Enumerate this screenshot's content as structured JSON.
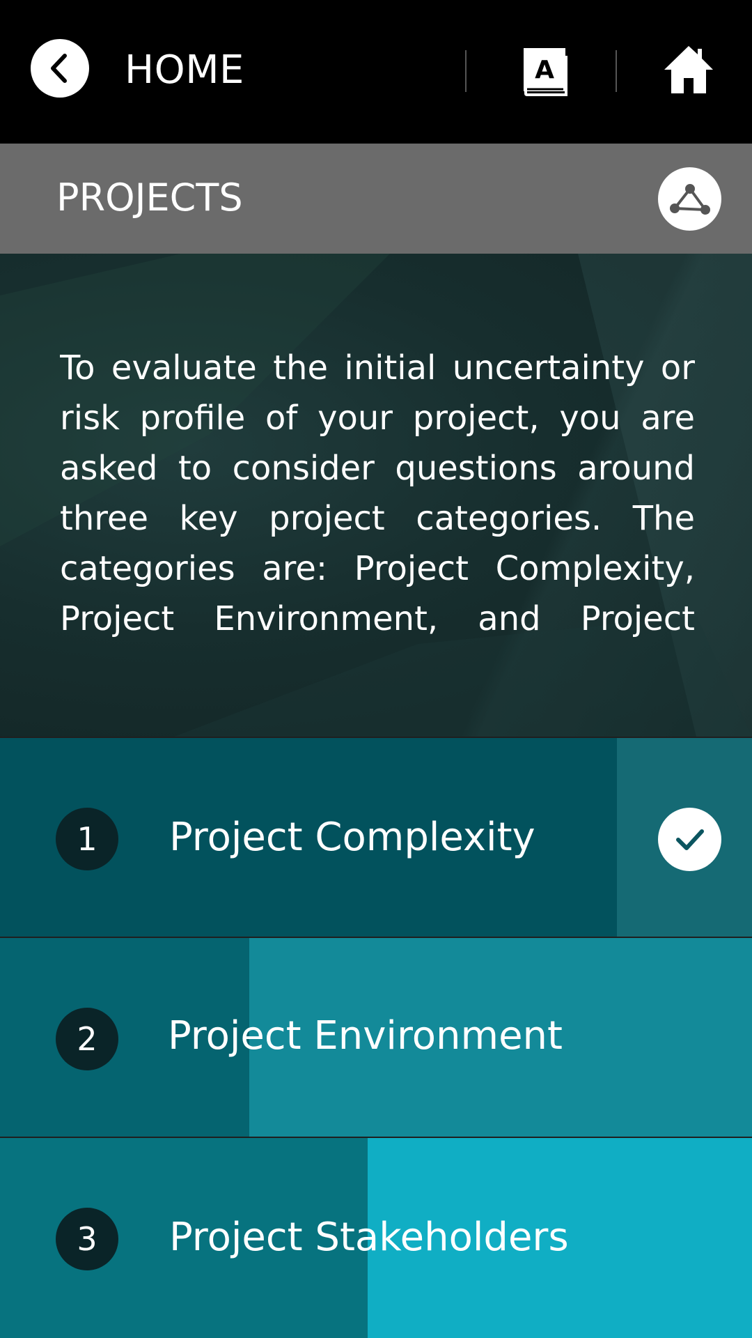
{
  "topbar": {
    "back_icon": "chevron-left-icon",
    "home_label": "HOME",
    "glossary_icon": "dictionary-book-icon",
    "glossary_letter": "A",
    "home_icon": "house-icon"
  },
  "section": {
    "title": "PROJECTS",
    "share_icon": "share-network-icon"
  },
  "intro": {
    "text": "To evaluate the initial uncertainty or risk profile of your project, you are asked to consider questions around three key project categories. The categories are: Project Complexity, Project Environment, and Project"
  },
  "categories": [
    {
      "number": "1",
      "label": "Project Complexity",
      "completed": true,
      "status_icon": "checkmark-icon"
    },
    {
      "number": "2",
      "label": "Project Environment",
      "completed": false
    },
    {
      "number": "3",
      "label": "Project Stakeholders",
      "completed": false
    }
  ],
  "colors": {
    "topbar_bg": "#000000",
    "section_bg": "#6b6b6b",
    "intro_bg": "#172e2e",
    "row1_dark": "#02525d",
    "row1_light": "#156a74",
    "row2_dark": "#056470",
    "row2_light": "#138a99",
    "row3_dark": "#07737f",
    "row3_light": "#10aec4",
    "number_badge": "#0a2428",
    "check_color": "#0b5560"
  }
}
